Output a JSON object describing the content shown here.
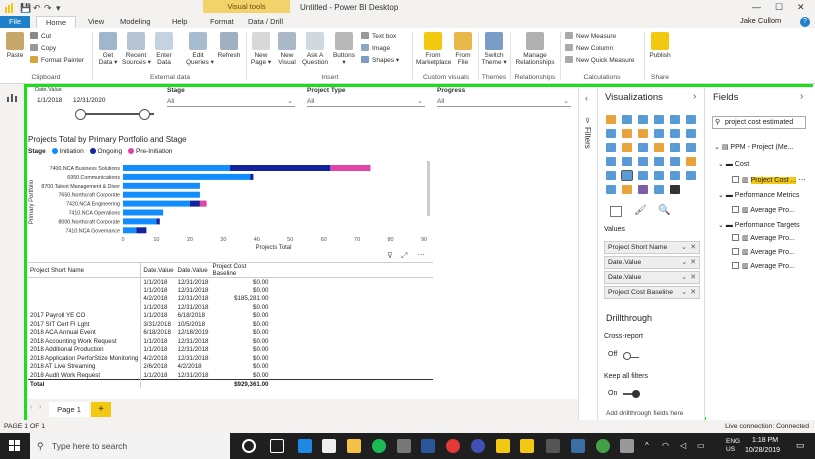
{
  "titlebar": {
    "contextual_tab": "Visual tools",
    "title": "Untitled - Power BI Desktop",
    "minimize": "—",
    "maximize": "☐",
    "close": "✕"
  },
  "tabs": [
    {
      "label": "File"
    },
    {
      "label": "Home"
    },
    {
      "label": "View"
    },
    {
      "label": "Modeling"
    },
    {
      "label": "Help"
    },
    {
      "label": "Format"
    },
    {
      "label": "Data / Drill"
    }
  ],
  "user": "Jake Cullom",
  "help_label": "?",
  "ribbon": {
    "paste": "Paste",
    "cut": "Cut",
    "copy": "Copy",
    "format_painter": "Format Painter",
    "get_data": "Get\nData ▾",
    "recent_sources": "Recent\nSources ▾",
    "enter_data": "Enter\nData",
    "edit_queries": "Edit\nQueries ▾",
    "refresh": "Refresh",
    "new_page": "New\nPage ▾",
    "new_visual": "New\nVisual",
    "ask_question": "Ask A\nQuestion",
    "buttons": "Buttons\n▾",
    "text_box": "Text box",
    "image": "Image",
    "shapes": "Shapes ▾",
    "from_marketplace": "From\nMarketplace",
    "from_file": "From\nFile",
    "switch_theme": "Switch\nTheme ▾",
    "manage_relationships": "Manage\nRelationships",
    "new_measure": "New Measure",
    "new_column": "New Column",
    "new_quick_measure": "New Quick Measure",
    "publish": "Publish",
    "groups": {
      "clipboard": "Clipboard",
      "external_data": "External data",
      "insert": "Insert",
      "custom_visuals": "Custom visuals",
      "themes": "Themes",
      "relationships": "Relationships",
      "calculations": "Calculations",
      "share": "Share"
    }
  },
  "slicers": {
    "date_label": "Date.Value",
    "date_from": "1/1/2018",
    "date_to": "12/31/2020",
    "stage_label": "Stage",
    "stage_value": "All",
    "project_type_label": "Project Type",
    "project_type_value": "All",
    "progress_label": "Progress",
    "progress_value": "All"
  },
  "chart_data": {
    "type": "bar",
    "title": "Projects Total by Primary Portfolio and Stage",
    "legend_title": "Stage",
    "xlabel": "Projects Total",
    "ylabel": "Primary Portfolio",
    "categories": [
      "7400.NCA Business Solutions",
      "6950.Communications",
      "8700.Talent Management & Diver",
      "7650.Northcraft Corporate",
      "7420.NCA Engineering",
      "7410.NCA Operations",
      "8000.Northcraft Corporate",
      "7410.NCA Governance"
    ],
    "series": [
      {
        "name": "Initiation",
        "color": "#118dff",
        "values": [
          32,
          38,
          23,
          23,
          20,
          12,
          10,
          4
        ]
      },
      {
        "name": "Ongoing",
        "color": "#12239e",
        "values": [
          30,
          1,
          0,
          0,
          3,
          0,
          1,
          3
        ]
      },
      {
        "name": "Pre-Initiation",
        "color": "#e044a7",
        "values": [
          12,
          0,
          0,
          0,
          2,
          0,
          0,
          0
        ]
      }
    ],
    "xlim": [
      0,
      90
    ],
    "xticks": [
      0,
      10,
      20,
      30,
      40,
      50,
      60,
      70,
      80,
      90
    ],
    "grid": false,
    "legend_position": "top-left"
  },
  "table": {
    "headers": [
      "Project Short Name",
      "Date.Value",
      "Date.Value",
      "Project Cost Baseline"
    ],
    "rows": [
      [
        "",
        "1/1/2018",
        "12/31/2018",
        "$0.00"
      ],
      [
        "",
        "1/1/2018",
        "12/31/2018",
        "$0.00"
      ],
      [
        "",
        "4/2/2018",
        "12/31/2018",
        "$185,281.00"
      ],
      [
        "",
        "1/1/2018",
        "12/31/2018",
        "$0.00"
      ],
      [
        "2017 Payroll YE CO",
        "1/1/2018",
        "6/18/2018",
        "$0.00"
      ],
      [
        "2017 SIT Cert FI Lght",
        "3/31/2018",
        "10/5/2018",
        "$0.00"
      ],
      [
        "2018 ACA Annual Event",
        "6/18/2018",
        "12/18/2019",
        "$0.00"
      ],
      [
        "2018 Accounting Work Request",
        "1/1/2018",
        "12/31/2018",
        "$0.00"
      ],
      [
        "2018 Additional Production",
        "1/1/2018",
        "12/31/2018",
        "$0.00"
      ],
      [
        "2018 Application PerforStize Monitoring",
        "4/2/2018",
        "12/31/2018",
        "$0.00"
      ],
      [
        "2018 AT Live Streaming",
        "2/6/2018",
        "4/2/2018",
        "$0.00"
      ],
      [
        "2018 Audit Work Request",
        "1/1/2018",
        "12/31/2018",
        "$0.00"
      ]
    ],
    "total_label": "Total",
    "total_value": "$929,361.00"
  },
  "pages": {
    "page1": "Page 1",
    "add": "+"
  },
  "filters_label": "Filters",
  "viz": {
    "title": "Visualizations",
    "values_label": "Values",
    "wells": [
      "Project Short Name",
      "Date.Value",
      "Date.Value",
      "Project Cost Baseline"
    ],
    "drillthrough": "Drillthrough",
    "cross_report": "Cross-report",
    "off": "Off",
    "keep_filters": "Keep all filters",
    "on": "On",
    "add_drill": "Add drillthrough fields here"
  },
  "fields": {
    "title": "Fields",
    "search_value": "project cost estimated",
    "table_name": "PPM - Project (Me...",
    "cost_folder": "Cost",
    "cost_field": "Project Cost ...",
    "perf_metrics": "Performance Metrics",
    "perf_metrics_field": "Average Pro...",
    "perf_targets": "Performance Targets",
    "perf_targets_fields": [
      "Average Pro...",
      "Average Pro...",
      "Average Pro..."
    ]
  },
  "status": {
    "page": "PAGE 1 OF 1",
    "connection": "Live connection: Connected"
  },
  "taskbar": {
    "search": "Type here to search",
    "lang": "ENG\nUS",
    "time": "1:18 PM",
    "date": "10/28/2019"
  },
  "colors": {
    "accent_green": "#19e01b",
    "file_blue": "#1f7fc9",
    "highlight": "#f2c811",
    "bar_initiation": "#118dff",
    "bar_ongoing": "#12239e",
    "bar_preinit": "#e044a7"
  }
}
